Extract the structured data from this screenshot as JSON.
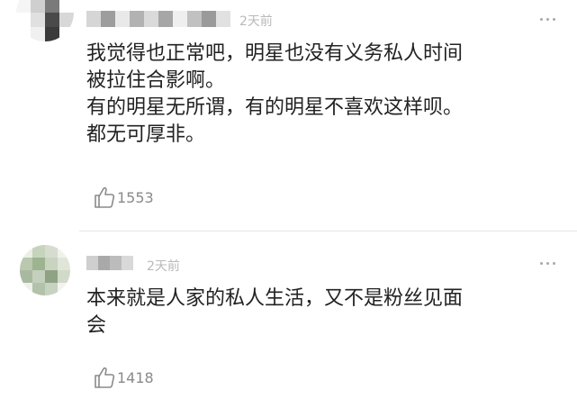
{
  "comments": [
    {
      "username_mosaic": [
        "#d6d6d6",
        "#9d9d9d",
        "#e9e9e9",
        "#b2b2b2",
        "#dadada",
        "#a6a6a6",
        "#efefef",
        "#c1c1c1",
        "#9a9a9a",
        "#e1e1e1"
      ],
      "avatar_mosaic": [
        "#f2f2f2",
        "#e6e6e6",
        "#bdbdbd",
        "#ffffff",
        "#f5f5f5",
        "#cfcfcf",
        "#7a7a7a",
        "#ffffff",
        "#ffffff",
        "#e0e0e0",
        "#4a4a4a",
        "#d8d8d8",
        "#ffffff",
        "#f0f0f0",
        "#3a3a3a",
        "#ffffff"
      ],
      "time": "2天前",
      "lines": [
        "我觉得也正常吧，明星也没有义务私人时间",
        "被拉住合影啊。",
        "有的明星无所谓，有的明星不喜欢这样呗。",
        "都无可厚非。"
      ],
      "likes": "1553"
    },
    {
      "username_mosaic": [
        "#cfcfcf",
        "#a9a9a9",
        "#bcbcbc",
        "#d9d9d9"
      ],
      "avatar_mosaic": [
        "#e9efe6",
        "#c6d3bd",
        "#d6dccf",
        "#eef2ea",
        "#b9c8ae",
        "#9eb38f",
        "#c9d4c0",
        "#dfe6d8",
        "#a8b9a0",
        "#c5cfbd",
        "#8ea384",
        "#d1dac8",
        "#edf1e9",
        "#b3c2aa",
        "#c8d2c0",
        "#f2f4ef"
      ],
      "time": "2天前",
      "lines": [
        "本来就是人家的私人生活，又不是粉丝见面",
        "会"
      ],
      "likes": "1418"
    }
  ],
  "icons": {
    "like": "thumbs-up-icon",
    "more": "more-dots-icon"
  },
  "colors": {
    "text": "#222222",
    "meta": "#b9b9b9",
    "icon": "#8a8a8a"
  }
}
